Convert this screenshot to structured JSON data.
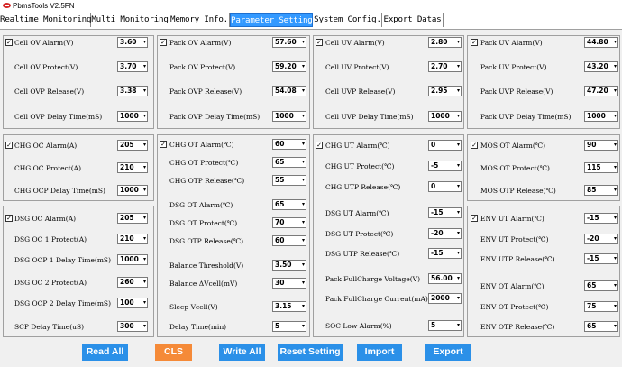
{
  "app": {
    "title": "PbmsTools V2.5FN"
  },
  "tabs": [
    {
      "label": "Realtime Monitoring"
    },
    {
      "label": "Multi Monitoring"
    },
    {
      "label": "Memory Info."
    },
    {
      "label": "Parameter Setting"
    },
    {
      "label": "System Config."
    },
    {
      "label": "Export Datas"
    }
  ],
  "groups": {
    "cell_ov": {
      "title": "Cell OV Alarm(V)",
      "value": "3.60",
      "rows": [
        {
          "label": "Cell OV Protect(V)",
          "value": "3.70"
        },
        {
          "label": "Cell OVP Release(V)",
          "value": "3.38"
        },
        {
          "label": "Cell OVP Delay Time(mS)",
          "value": "1000"
        }
      ]
    },
    "pack_ov": {
      "title": "Pack OV Alarm(V)",
      "value": "57.60",
      "rows": [
        {
          "label": "Pack OV Protect(V)",
          "value": "59.20"
        },
        {
          "label": "Pack OVP Release(V)",
          "value": "54.08"
        },
        {
          "label": "Pack OVP Delay Time(mS)",
          "value": "1000"
        }
      ]
    },
    "cell_uv": {
      "title": "Cell UV Alarm(V)",
      "value": "2.80",
      "rows": [
        {
          "label": "Cell UV Protect(V)",
          "value": "2.70"
        },
        {
          "label": "Cell UVP Release(V)",
          "value": "2.95"
        },
        {
          "label": "Cell UVP Delay Time(mS)",
          "value": "1000"
        }
      ]
    },
    "pack_uv": {
      "title": "Pack UV Alarm(V)",
      "value": "44.80",
      "rows": [
        {
          "label": "Pack UV Protect(V)",
          "value": "43.20"
        },
        {
          "label": "Pack UVP Release(V)",
          "value": "47.20"
        },
        {
          "label": "Pack UVP Delay Time(mS)",
          "value": "1000"
        }
      ]
    },
    "chg_oc": {
      "title": "CHG OC Alarm(A)",
      "value": "205",
      "rows": [
        {
          "label": "CHG OC Protect(A)",
          "value": "210"
        },
        {
          "label": "CHG OCP Delay Time(mS)",
          "value": "1000"
        }
      ]
    },
    "dsg_oc": {
      "title": "DSG OC Alarm(A)",
      "value": "205",
      "rows": [
        {
          "label": "DSG OC 1 Protect(A)",
          "value": "210"
        },
        {
          "label": "DSG OCP 1 Delay Time(mS)",
          "value": "1000"
        },
        {
          "label": "DSG OC 2 Protect(A)",
          "value": "260"
        },
        {
          "label": "DSG OCP 2 Delay Time(mS)",
          "value": "100"
        },
        {
          "label": "SCP Delay Time(uS)",
          "value": "300"
        }
      ]
    },
    "chg_ot": {
      "title": "CHG OT Alarm(℃)",
      "value": "60",
      "rows": [
        {
          "label": "CHG OT Protect(℃)",
          "value": "65"
        },
        {
          "label": "CHG OTP Release(℃)",
          "value": "55"
        },
        {
          "label": "DSG OT Alarm(℃)",
          "value": "65"
        },
        {
          "label": "DSG OT Protect(℃)",
          "value": "70"
        },
        {
          "label": "DSG OTP Release(℃)",
          "value": "60"
        },
        {
          "label": "Balance Threshold(V)",
          "value": "3.50"
        },
        {
          "label": "Balance ΔVcell(mV)",
          "value": "30"
        },
        {
          "label": "Sleep Vcell(V)",
          "value": "3.15"
        },
        {
          "label": "Delay Time(min)",
          "value": "5"
        }
      ]
    },
    "chg_ut": {
      "title": "CHG UT Alarm(℃)",
      "value": "0",
      "rows": [
        {
          "label": "CHG UT Protect(℃)",
          "value": "-5"
        },
        {
          "label": "CHG UTP Release(℃)",
          "value": "0"
        },
        {
          "label": "DSG UT Alarm(℃)",
          "value": "-15"
        },
        {
          "label": "DSG UT Protect(℃)",
          "value": "-20"
        },
        {
          "label": "DSG UTP Release(℃)",
          "value": "-15"
        },
        {
          "label": "Pack FullCharge Voltage(V)",
          "value": "56.00"
        },
        {
          "label": "Pack FullCharge Current(mA)",
          "value": "2000"
        },
        {
          "label": "SOC Low Alarm(%)",
          "value": "5"
        }
      ]
    },
    "mos_ot": {
      "title": "MOS OT Alarm(℃)",
      "value": "90",
      "rows": [
        {
          "label": "MOS OT Protect(℃)",
          "value": "115"
        },
        {
          "label": "MOS OTP Release(℃)",
          "value": "85"
        }
      ]
    },
    "env": {
      "title": "ENV UT Alarm(℃)",
      "value": "-15",
      "rows": [
        {
          "label": "ENV UT Protect(℃)",
          "value": "-20"
        },
        {
          "label": "ENV UTP Release(℃)",
          "value": "-15"
        },
        {
          "label": "ENV OT Alarm(℃)",
          "value": "65"
        },
        {
          "label": "ENV OT Protect(℃)",
          "value": "75"
        },
        {
          "label": "ENV OTP Release(℃)",
          "value": "65"
        }
      ]
    }
  },
  "buttons": {
    "read_all": "Read All",
    "cls": "CLS",
    "write_all": "Write All",
    "reset_setting": "Reset Setting",
    "import": "Import",
    "export": "Export"
  },
  "colors": {
    "active_tab": "#3399ff",
    "button_blue": "#2b90e8",
    "button_orange": "#f58a38"
  }
}
